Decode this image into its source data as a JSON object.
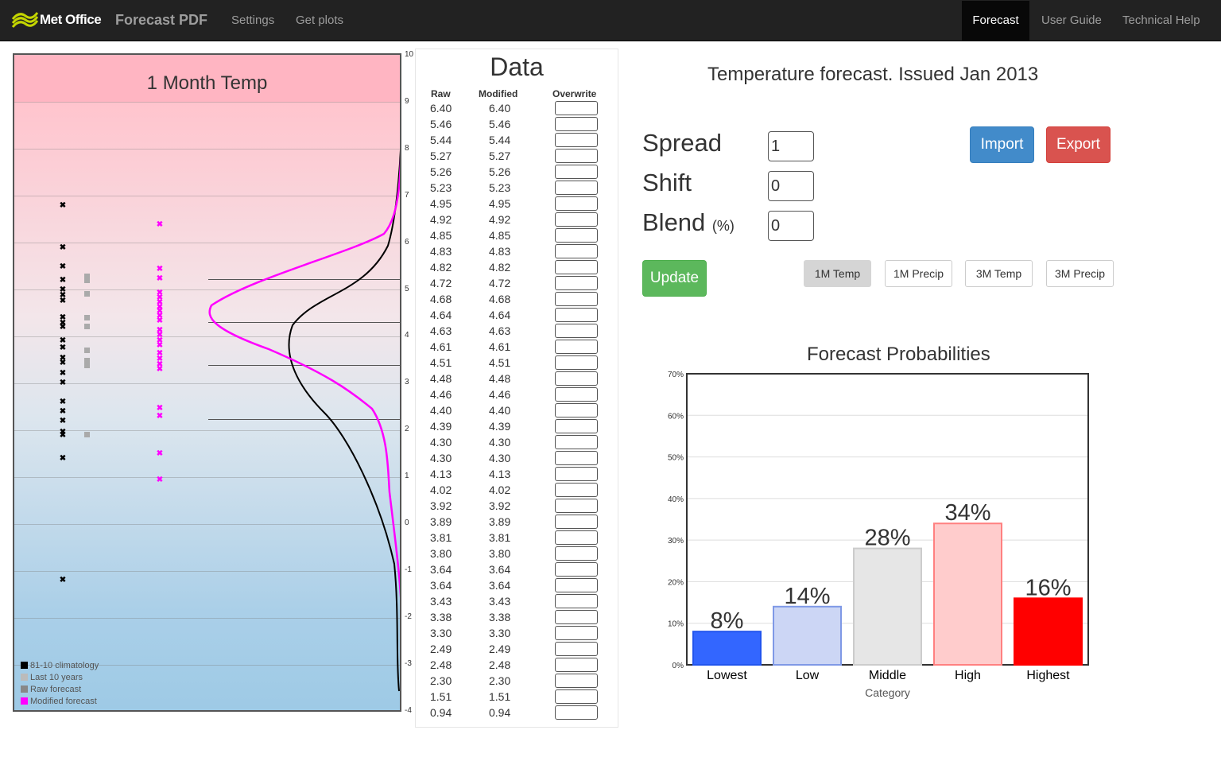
{
  "navbar": {
    "brand": "Met Office",
    "app_name": "Forecast PDF",
    "links_left": [
      "Settings",
      "Get plots"
    ],
    "active_tab": "Forecast",
    "links_right": [
      "User Guide",
      "Technical Help"
    ]
  },
  "plot": {
    "title": "1 Month Temp",
    "y_axis": [
      "10",
      "9",
      "8",
      "7",
      "6",
      "5",
      "4",
      "3",
      "2",
      "1",
      "0",
      "-1",
      "-2",
      "-3",
      "-4"
    ],
    "legend": [
      {
        "label": "81-10 climatology",
        "color": "#000000"
      },
      {
        "label": "Last 10 years",
        "color": "#bbbbbb"
      },
      {
        "label": "Raw forecast",
        "color": "#888888"
      },
      {
        "label": "Modified forecast",
        "color": "#ff00ff"
      }
    ]
  },
  "data_table": {
    "title": "Data",
    "headers": [
      "Raw",
      "Modified",
      "Overwrite"
    ],
    "rows": [
      [
        "6.40",
        "6.40"
      ],
      [
        "5.46",
        "5.46"
      ],
      [
        "5.44",
        "5.44"
      ],
      [
        "5.27",
        "5.27"
      ],
      [
        "5.26",
        "5.26"
      ],
      [
        "5.23",
        "5.23"
      ],
      [
        "4.95",
        "4.95"
      ],
      [
        "4.92",
        "4.92"
      ],
      [
        "4.85",
        "4.85"
      ],
      [
        "4.83",
        "4.83"
      ],
      [
        "4.82",
        "4.82"
      ],
      [
        "4.72",
        "4.72"
      ],
      [
        "4.68",
        "4.68"
      ],
      [
        "4.64",
        "4.64"
      ],
      [
        "4.63",
        "4.63"
      ],
      [
        "4.61",
        "4.61"
      ],
      [
        "4.51",
        "4.51"
      ],
      [
        "4.48",
        "4.48"
      ],
      [
        "4.46",
        "4.46"
      ],
      [
        "4.40",
        "4.40"
      ],
      [
        "4.39",
        "4.39"
      ],
      [
        "4.30",
        "4.30"
      ],
      [
        "4.30",
        "4.30"
      ],
      [
        "4.13",
        "4.13"
      ],
      [
        "4.02",
        "4.02"
      ],
      [
        "3.92",
        "3.92"
      ],
      [
        "3.89",
        "3.89"
      ],
      [
        "3.81",
        "3.81"
      ],
      [
        "3.80",
        "3.80"
      ],
      [
        "3.64",
        "3.64"
      ],
      [
        "3.64",
        "3.64"
      ],
      [
        "3.43",
        "3.43"
      ],
      [
        "3.38",
        "3.38"
      ],
      [
        "3.30",
        "3.30"
      ],
      [
        "2.49",
        "2.49"
      ],
      [
        "2.48",
        "2.48"
      ],
      [
        "2.30",
        "2.30"
      ],
      [
        "1.51",
        "1.51"
      ],
      [
        "0.94",
        "0.94"
      ]
    ]
  },
  "controls": {
    "issued": "Temperature forecast. Issued Jan 2013",
    "spread_label": "Spread",
    "spread_value": "1",
    "shift_label": "Shift",
    "shift_value": "0",
    "blend_label": "Blend",
    "blend_unit": "(%)",
    "blend_value": "0",
    "import_label": "Import",
    "export_label": "Export",
    "update_label": "Update",
    "toggles": [
      "1M Temp",
      "1M Precip",
      "3M Temp",
      "3M Precip"
    ],
    "active_toggle": "1M Temp"
  },
  "chart_data": {
    "type": "bar",
    "title": "Forecast Probabilities",
    "categories": [
      "Lowest",
      "Low",
      "Middle",
      "High",
      "Highest"
    ],
    "values": [
      8,
      14,
      28,
      34,
      16
    ],
    "value_labels": [
      "8%",
      "14%",
      "28%",
      "34%",
      "16%"
    ],
    "colors": [
      "#3366ff",
      "#ccd6f5",
      "#e6e6e6",
      "#ffcccc",
      "#ff0000"
    ],
    "xlabel": "Category",
    "ylabel": "",
    "ylim": [
      0,
      70
    ],
    "yticks": [
      "0%",
      "10%",
      "20%",
      "30%",
      "40%",
      "50%",
      "60%",
      "70%"
    ],
    "grid": true
  }
}
